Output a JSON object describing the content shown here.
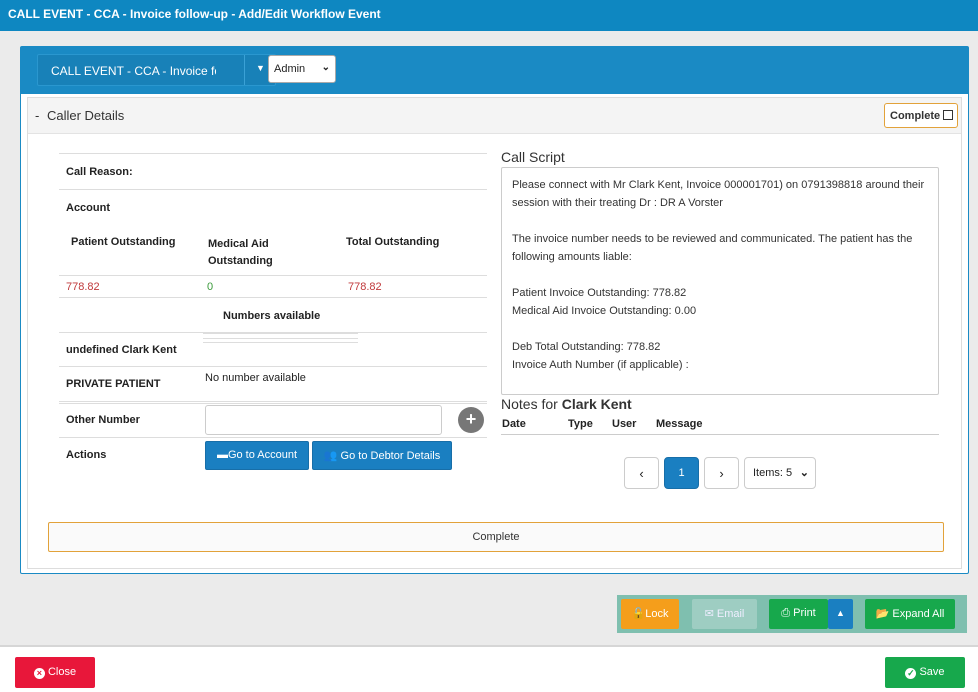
{
  "window": {
    "title": "CALL EVENT - CCA - Invoice follow-up - Add/Edit Workflow Event"
  },
  "header": {
    "event_select": "CALL EVENT - CCA - Invoice follow-up",
    "role_select": "Admin"
  },
  "section": {
    "toggle": "-",
    "title": "Caller Details",
    "complete_label": "Complete"
  },
  "caller": {
    "call_reason_label": "Call Reason:",
    "account_label": "Account",
    "patient_outstanding_label": "Patient Outstanding",
    "medical_aid_outstanding_label": "Medical Aid Outstanding",
    "total_outstanding_label": "Total Outstanding",
    "patient_outstanding_value": "778.82",
    "medical_aid_outstanding_value": "0",
    "total_outstanding_value": "778.82",
    "numbers_available_label": "Numbers available",
    "contact_name": "undefined Clark Kent",
    "private_patient_label": "PRIVATE PATIENT",
    "private_patient_value": "No number available",
    "other_number_label": "Other Number",
    "other_number_value": "",
    "actions_label": "Actions",
    "go_to_account": "Go to Account",
    "go_to_debtor": "Go to Debtor Details"
  },
  "script": {
    "title": "Call Script",
    "line1": "Please connect with  Mr Clark Kent, Invoice 000001701) on 0791398818 around their session with their treating Dr :  DR A Vorster",
    "line2": "The invoice number  needs to be reviewed and communicated. The patient has the following amounts liable:",
    "line3": "Patient Invoice Outstanding: 778.82",
    "line4": "Medical Aid Invoice Outstanding:  0.00",
    "line5": "Deb Total Outstanding: 778.82",
    "line6": "Invoice Auth Number (if applicable) :"
  },
  "notes": {
    "title_prefix": "Notes for ",
    "title_name": "Clark Kent",
    "columns": [
      "Date",
      "Type",
      "User",
      "Message"
    ]
  },
  "pager": {
    "prev": "‹",
    "page": "1",
    "next": "›",
    "items": "Items: 5"
  },
  "complete_bar": "Complete",
  "actions": {
    "lock": "Lock",
    "email": "Email",
    "print": "Print",
    "expand_all": "Expand All"
  },
  "footer": {
    "close": "Close",
    "save": "Save"
  },
  "colors": {
    "brand": "#1a8ac4",
    "complete_border": "#e2a23a",
    "danger": "#e8173a",
    "success": "#17a84c",
    "lock": "#f59e1b"
  }
}
